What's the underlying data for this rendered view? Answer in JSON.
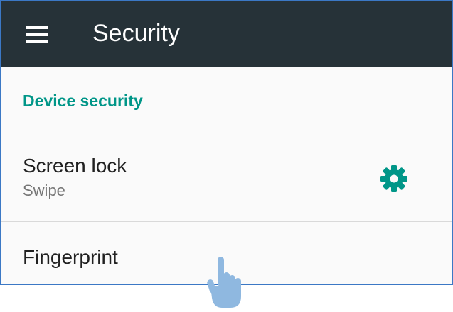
{
  "app_bar": {
    "menu_icon": "hamburger-menu-icon",
    "title": "Security",
    "background": "#263238"
  },
  "section": {
    "header": "Device security",
    "accent_color": "#009688"
  },
  "preferences": [
    {
      "title": "Screen lock",
      "summary": "Swipe",
      "action_icon": "gear-icon"
    },
    {
      "title": "Fingerprint"
    }
  ],
  "cursor": {
    "icon": "pointing-hand-cursor-icon",
    "color": "#8fb8e0"
  }
}
